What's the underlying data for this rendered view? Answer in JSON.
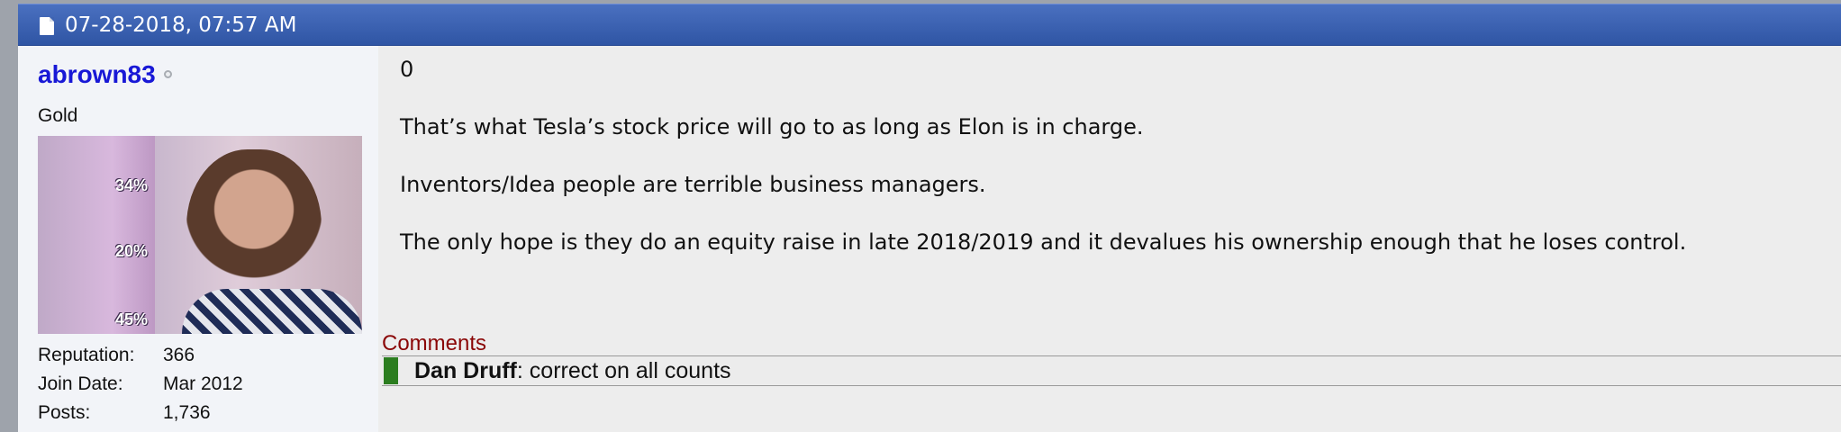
{
  "post": {
    "date": "07-28-2018, 07:57 AM",
    "icons": {
      "header": "document-icon",
      "status": "offline-status-icon"
    }
  },
  "user": {
    "username": "abrown83",
    "title": "Gold",
    "avatar_percentages": [
      "34%",
      "20%",
      "45%"
    ],
    "info": [
      {
        "label": "Reputation:",
        "value": "366"
      },
      {
        "label": "Join Date:",
        "value": "Mar 2012"
      },
      {
        "label": "Posts:",
        "value": "1,736"
      }
    ]
  },
  "message": {
    "paragraphs": [
      "0",
      "That’s what Tesla’s stock price will go to as long as Elon is in charge.",
      "Inventors/Idea people are terrible business managers.",
      "The only hope is they do an equity raise in late 2018/2019 and it devalues his ownership enough that he loses control."
    ]
  },
  "comments": {
    "label": "Comments",
    "items": [
      {
        "author": "Dan Druff",
        "separator": ": ",
        "text": "correct on all counts"
      }
    ]
  },
  "colors": {
    "header_blue": "#3f63b1",
    "username_blue": "#1818d6",
    "comments_red": "#8a0606",
    "comment_marker_green": "#2b7d1f"
  }
}
